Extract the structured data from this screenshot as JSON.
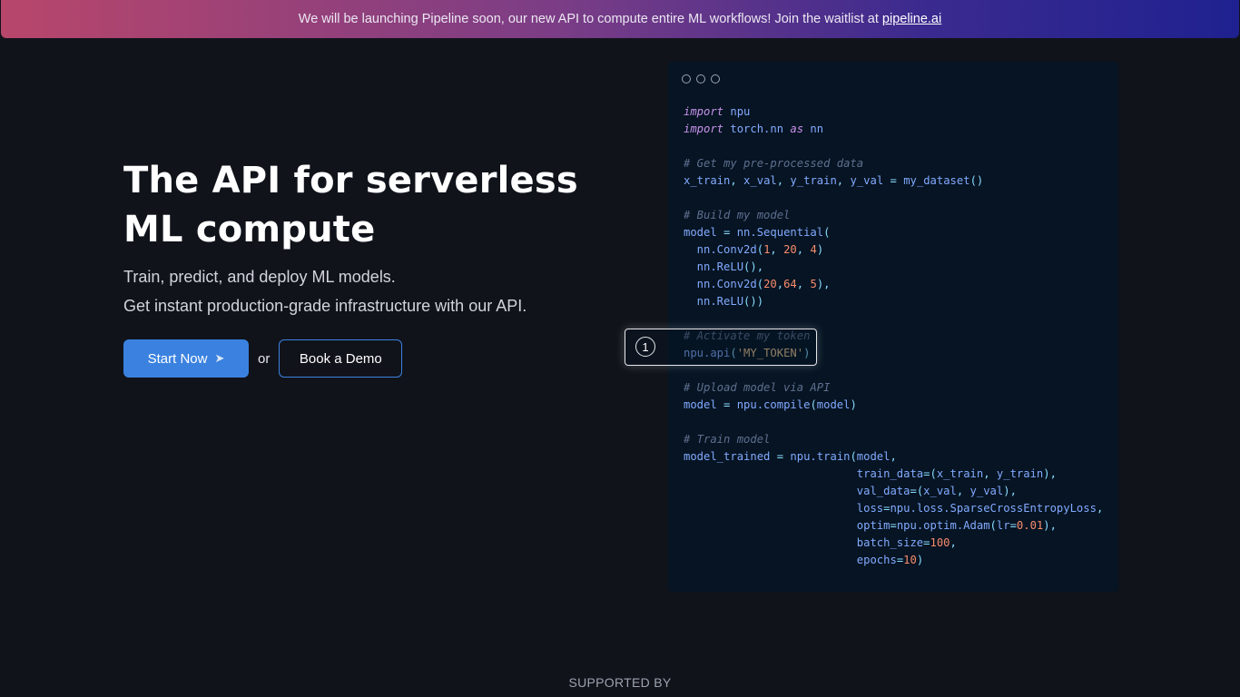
{
  "banner": {
    "text": "We will be launching Pipeline soon, our new API to compute entire ML workflows! Join the waitlist at",
    "link_text": "pipeline.ai"
  },
  "hero": {
    "title_line1": "The API for serverless",
    "title_line2": "ML compute",
    "subtitle1": "Train, predict, and deploy ML models.",
    "subtitle2": "Get instant production-grade infrastructure with our API.",
    "primary_button": "Start Now",
    "primary_button_icon": "rocket-icon",
    "or_text": "or",
    "secondary_button": "Book a Demo"
  },
  "code_window": {
    "lines": [
      "import npu",
      "import torch.nn as nn",
      "",
      "# Get my pre-processed data",
      "x_train, x_val, y_train, y_val = my_dataset()",
      "",
      "# Build my model",
      "model = nn.Sequential(",
      "  nn.Conv2d(1, 20, 4)",
      "  nn.ReLU(),",
      "  nn.Conv2d(20,64, 5),",
      "  nn.ReLU())",
      "",
      "# Activate my token",
      "npu.api('MY_TOKEN')",
      "",
      "# Upload model via API",
      "model = npu.compile(model)",
      "",
      "# Train model",
      "model_trained = npu.train(model,",
      "                          train_data=(x_train, y_train),",
      "                          val_data=(x_val, y_val),",
      "                          loss=npu.loss.SparseCrossEntropyLoss,",
      "                          optim=npu.optim.Adam(lr=0.01),",
      "                          batch_size=100,",
      "                          epochs=10)"
    ],
    "callout_step": "1"
  },
  "footer": {
    "supported_by": "SUPPORTED BY"
  },
  "colors": {
    "background": "#11131b",
    "accent": "#3b82e0",
    "code_background": "#061423"
  }
}
